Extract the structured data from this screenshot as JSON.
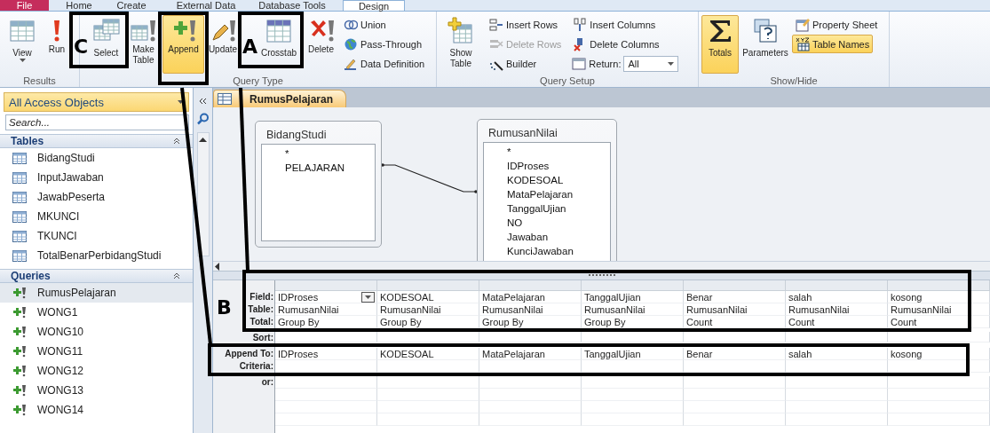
{
  "ribbon_tabs": [
    {
      "label": "File",
      "kind": "file",
      "selected": false
    },
    {
      "label": "Home",
      "kind": "tab",
      "selected": false
    },
    {
      "label": "Create",
      "kind": "tab",
      "selected": false
    },
    {
      "label": "External Data",
      "kind": "tab",
      "selected": false
    },
    {
      "label": "Database Tools",
      "kind": "tab",
      "selected": false
    },
    {
      "label": "Design",
      "kind": "tab",
      "selected": true
    }
  ],
  "ribbon_groups": [
    {
      "label": "Results",
      "items": [
        {
          "kind": "split",
          "label": "View",
          "selected": false
        },
        {
          "kind": "large",
          "label": "Run",
          "selected": false
        }
      ]
    },
    {
      "label": "Query Type",
      "items": [
        {
          "kind": "large",
          "label": "Select",
          "selected": false
        },
        {
          "kind": "large",
          "label": "Make Table",
          "selected": false
        },
        {
          "kind": "large",
          "label": "Append",
          "selected": true
        },
        {
          "kind": "large",
          "label": "Update",
          "selected": false
        },
        {
          "kind": "large",
          "label": "Crosstab",
          "selected": false
        },
        {
          "kind": "large",
          "label": "Delete",
          "selected": false
        },
        {
          "kind": "stack",
          "items": [
            {
              "kind": "button",
              "label": "Union",
              "disabled": false,
              "selected": false
            },
            {
              "kind": "button",
              "label": "Pass-Through",
              "disabled": false,
              "selected": false
            },
            {
              "kind": "button",
              "label": "Data Definition",
              "disabled": false,
              "selected": false
            }
          ]
        }
      ]
    },
    {
      "label": "Query Setup",
      "items": [
        {
          "kind": "large",
          "label": "Show Table",
          "selected": false
        },
        {
          "kind": "stack",
          "items": [
            {
              "kind": "button",
              "label": "Insert Rows",
              "disabled": false,
              "selected": false
            },
            {
              "kind": "button",
              "label": "Delete Rows",
              "disabled": true,
              "selected": false
            },
            {
              "kind": "button",
              "label": "Builder",
              "disabled": false,
              "selected": false
            }
          ]
        },
        {
          "kind": "stack",
          "items": [
            {
              "kind": "button",
              "label": "Insert Columns",
              "disabled": false,
              "selected": false
            },
            {
              "kind": "button",
              "label": "Delete Columns",
              "disabled": false,
              "selected": false
            },
            {
              "kind": "select",
              "label": "Return:",
              "value": "All"
            }
          ]
        }
      ]
    },
    {
      "label": "Show/Hide",
      "items": [
        {
          "kind": "large",
          "label": "Totals",
          "selected": true
        },
        {
          "kind": "large",
          "label": "Parameters",
          "selected": false
        },
        {
          "kind": "stack",
          "items": [
            {
              "kind": "button",
              "label": "Property Sheet",
              "disabled": false,
              "selected": false
            },
            {
              "kind": "button",
              "label": "Table Names",
              "disabled": false,
              "selected": true
            }
          ]
        }
      ]
    }
  ],
  "navigation": {
    "title": "All Access Objects",
    "search": {
      "placeholder": "Search..."
    },
    "groups": [
      {
        "title": "Tables",
        "kind": "table",
        "items": [
          {
            "label": "BidangStudi",
            "selected": false
          },
          {
            "label": "InputJawaban",
            "selected": false
          },
          {
            "label": "JawabPeserta",
            "selected": false
          },
          {
            "label": "MKUNCI",
            "selected": false
          },
          {
            "label": "TKUNCI",
            "selected": false
          },
          {
            "label": "TotalBenarPerbidangStudi",
            "selected": false
          }
        ]
      },
      {
        "title": "Queries",
        "kind": "query",
        "items": [
          {
            "label": "RumusPelajaran",
            "selected": true
          },
          {
            "label": "WONG1",
            "selected": false
          },
          {
            "label": "WONG10",
            "selected": false
          },
          {
            "label": "WONG11",
            "selected": false
          },
          {
            "label": "WONG12",
            "selected": false
          },
          {
            "label": "WONG13",
            "selected": false
          },
          {
            "label": "WONG14",
            "selected": false
          }
        ]
      }
    ]
  },
  "document_tab": {
    "label": "RumusPelajaran",
    "selected": true
  },
  "tables": [
    {
      "name": "BidangStudi",
      "fields": [
        "*",
        "PELAJARAN"
      ]
    },
    {
      "name": "RumusanNilai",
      "fields": [
        "*",
        "IDProses",
        "KODESOAL",
        "MataPelajaran",
        "TanggalUjian",
        "NO",
        "Jawaban",
        "KunciJawaban"
      ]
    }
  ],
  "grid": {
    "row_labels": [
      "Field:",
      "Table:",
      "Total:",
      "Sort:",
      "Append To:",
      "Criteria:",
      "or:"
    ],
    "columns": [
      {
        "field": "IDProses",
        "table": "RumusanNilai",
        "total": "Group By",
        "append_to": "IDProses",
        "focused": true
      },
      {
        "field": "KODESOAL",
        "table": "RumusanNilai",
        "total": "Group By",
        "append_to": "KODESOAL",
        "focused": false
      },
      {
        "field": "MataPelajaran",
        "table": "RumusanNilai",
        "total": "Group By",
        "append_to": "MataPelajaran",
        "focused": false
      },
      {
        "field": "TanggalUjian",
        "table": "RumusanNilai",
        "total": "Group By",
        "append_to": "TanggalUjian",
        "focused": false
      },
      {
        "field": "Benar",
        "table": "RumusanNilai",
        "total": "Count",
        "append_to": "Benar",
        "focused": false
      },
      {
        "field": "salah",
        "table": "RumusanNilai",
        "total": "Count",
        "append_to": "salah",
        "focused": false
      },
      {
        "field": "kosong",
        "table": "RumusanNilai",
        "total": "Count",
        "append_to": "kosong",
        "focused": false
      }
    ]
  },
  "annotations": [
    {
      "letter": "C"
    },
    {
      "letter": "A"
    },
    {
      "letter": "B"
    }
  ]
}
